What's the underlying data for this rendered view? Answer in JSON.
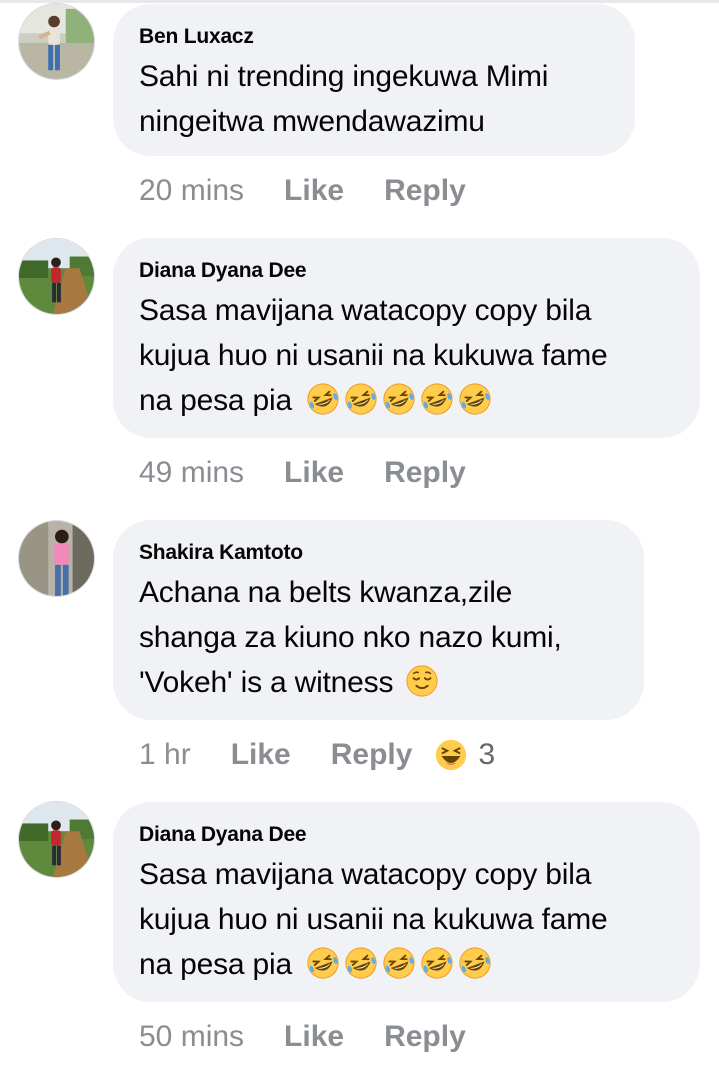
{
  "comments": [
    {
      "author": "Ben Luxacz",
      "lines": [
        "Sahi ni trending ingekuwa Mimi",
        "ningeitwa mwendawazimu"
      ],
      "time": "20 mins",
      "like_label": "Like",
      "reply_label": "Reply",
      "avatar": "person-on-wall-avatar"
    },
    {
      "author": "Diana Dyana Dee",
      "lines": [
        "Sasa mavijana watacopy copy bila",
        "kujua huo ni usanii na kukuwa fame",
        "na pesa pia"
      ],
      "emojis": [
        "rolling-laughing-emoji",
        "rolling-laughing-emoji",
        "rolling-laughing-emoji",
        "rolling-laughing-emoji",
        "rolling-laughing-emoji"
      ],
      "time": "49 mins",
      "like_label": "Like",
      "reply_label": "Reply",
      "avatar": "person-on-road-avatar"
    },
    {
      "author": "Shakira Kamtoto",
      "lines": [
        "Achana na belts kwanza,zile",
        "shanga za kiuno nko nazo kumi,",
        "'Vokeh' is a witness"
      ],
      "emojis": [
        "relieved-face-emoji"
      ],
      "time": "1 hr",
      "like_label": "Like",
      "reply_label": "Reply",
      "reaction": {
        "icon": "haha-reaction-icon",
        "count": "3"
      },
      "avatar": "person-in-pink-avatar"
    },
    {
      "author": "Diana Dyana Dee",
      "lines": [
        "Sasa mavijana watacopy copy bila",
        "kujua huo ni usanii na kukuwa fame",
        "na pesa pia"
      ],
      "emojis": [
        "rolling-laughing-emoji",
        "rolling-laughing-emoji",
        "rolling-laughing-emoji",
        "rolling-laughing-emoji",
        "rolling-laughing-emoji"
      ],
      "time": "50 mins",
      "like_label": "Like",
      "reply_label": "Reply",
      "avatar": "person-on-road-avatar"
    }
  ],
  "colors": {
    "bubble": "#f0f2f5",
    "text": "#050505",
    "meta": "#8a8d91",
    "emoji_yellow": "#ffcc4d"
  }
}
